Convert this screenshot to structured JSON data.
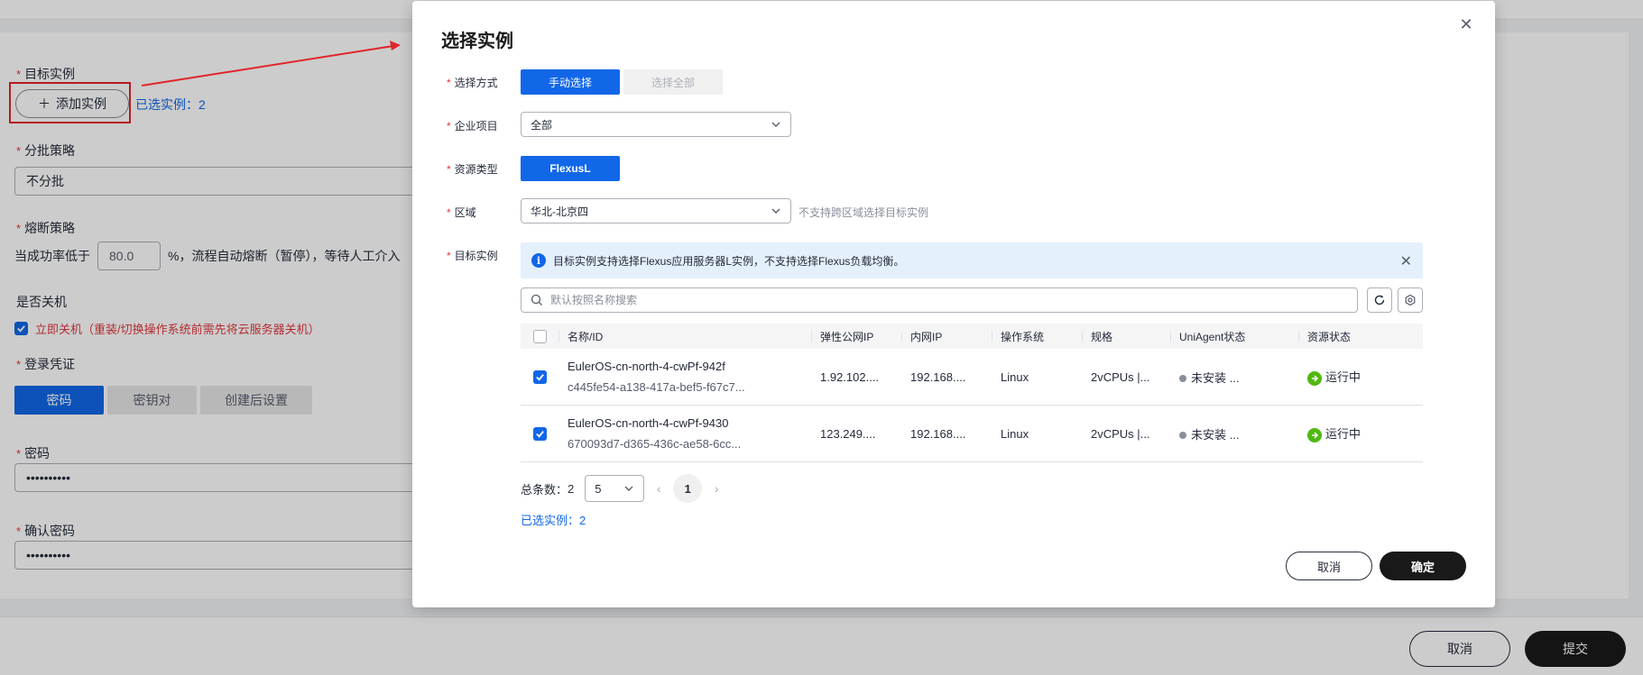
{
  "background_form": {
    "target_instance": {
      "label": "目标实例",
      "add_button": "添加实例",
      "selected_text": "已选实例：2"
    },
    "batch_strategy": {
      "label": "分批策略",
      "value": "不分批"
    },
    "circuit_breaker": {
      "label": "熔断策略",
      "prefix": "当成功率低于",
      "value": "80.0",
      "suffix": "%，流程自动熔断（暂停），等待人工介入"
    },
    "shutdown": {
      "label": "是否关机",
      "checkbox_text": "立即关机（重装/切换操作系统前需先将云服务器关机）",
      "checked": true
    },
    "login_credential": {
      "label": "登录凭证",
      "options": [
        "密码",
        "密钥对",
        "创建后设置"
      ],
      "active": "密码"
    },
    "password": {
      "label": "密码",
      "value": "••••••••••"
    },
    "confirm_password": {
      "label": "确认密码",
      "value": "••••••••••"
    },
    "footer": {
      "cancel": "取消",
      "submit": "提交"
    }
  },
  "modal": {
    "title": "选择实例",
    "select_mode": {
      "label": "选择方式",
      "options": [
        "手动选择",
        "选择全部"
      ],
      "active": "手动选择"
    },
    "enterprise_project": {
      "label": "企业项目",
      "value": "全部"
    },
    "resource_type": {
      "label": "资源类型",
      "value": "FlexusL"
    },
    "region": {
      "label": "区域",
      "value": "华北-北京四",
      "hint": "不支持跨区域选择目标实例"
    },
    "target_instance": {
      "label": "目标实例",
      "info": "目标实例支持选择Flexus应用服务器L实例，不支持选择Flexus负载均衡。",
      "search_placeholder": "默认按照名称搜索"
    },
    "table": {
      "columns": [
        "名称/ID",
        "弹性公网IP",
        "内网IP",
        "操作系统",
        "规格",
        "UniAgent状态",
        "资源状态"
      ],
      "rows": [
        {
          "checked": true,
          "name": "EulerOS-cn-north-4-cwPf-942f",
          "id": "c445fe54-a138-417a-bef5-f67c7...",
          "eip": "1.92.102....",
          "private_ip": "192.168....",
          "os": "Linux",
          "spec": "2vCPUs |...",
          "agent": "未安装 ...",
          "status": "运行中"
        },
        {
          "checked": true,
          "name": "EulerOS-cn-north-4-cwPf-9430",
          "id": "670093d7-d365-436c-ae58-6cc...",
          "eip": "123.249....",
          "private_ip": "192.168....",
          "os": "Linux",
          "spec": "2vCPUs |...",
          "agent": "未安装 ...",
          "status": "运行中"
        }
      ]
    },
    "pagination": {
      "total_label": "总条数：",
      "total": "2",
      "page_size": "5",
      "current_page": "1"
    },
    "selected_text": "已选实例：2",
    "buttons": {
      "cancel": "取消",
      "confirm": "确定"
    }
  },
  "colors": {
    "primary": "#1167e8",
    "danger": "#e0373e",
    "success": "#50b811",
    "dark_button": "#191919"
  }
}
